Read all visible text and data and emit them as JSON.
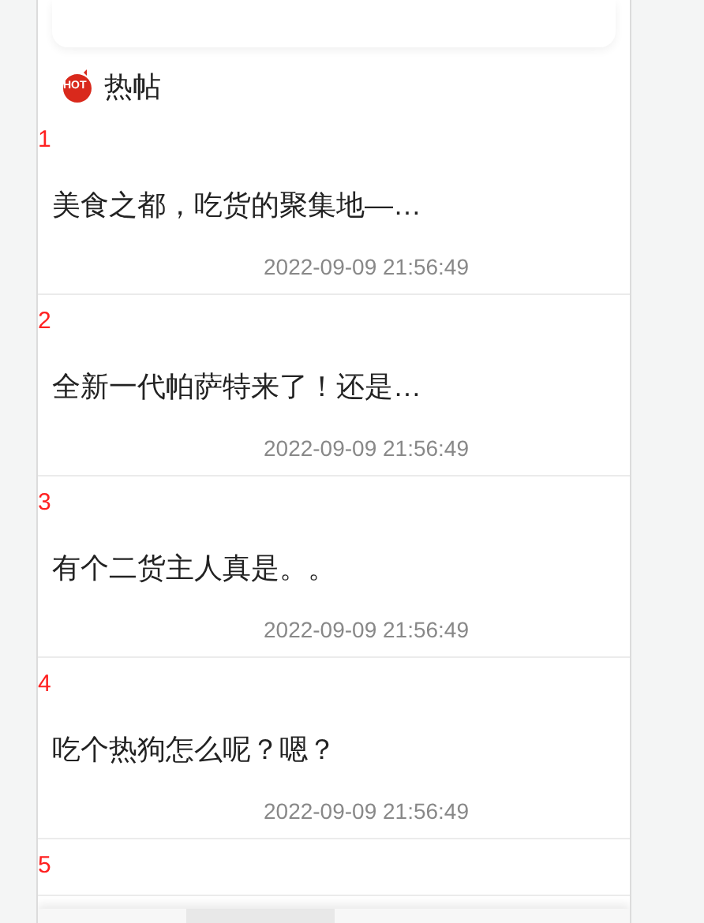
{
  "section": {
    "badge": "HOT",
    "title": "热帖"
  },
  "posts": [
    {
      "rank": "1",
      "title": "美食之都，吃货的聚集地—…",
      "time": "2022-09-09 21:56:49"
    },
    {
      "rank": "2",
      "title": "全新一代帕萨特来了！还是…",
      "time": "2022-09-09 21:56:49"
    },
    {
      "rank": "3",
      "title": "有个二货主人真是。。",
      "time": "2022-09-09 21:56:49"
    },
    {
      "rank": "4",
      "title": "吃个热狗怎么呢？嗯？",
      "time": "2022-09-09 21:56:49"
    },
    {
      "rank": "5"
    }
  ]
}
